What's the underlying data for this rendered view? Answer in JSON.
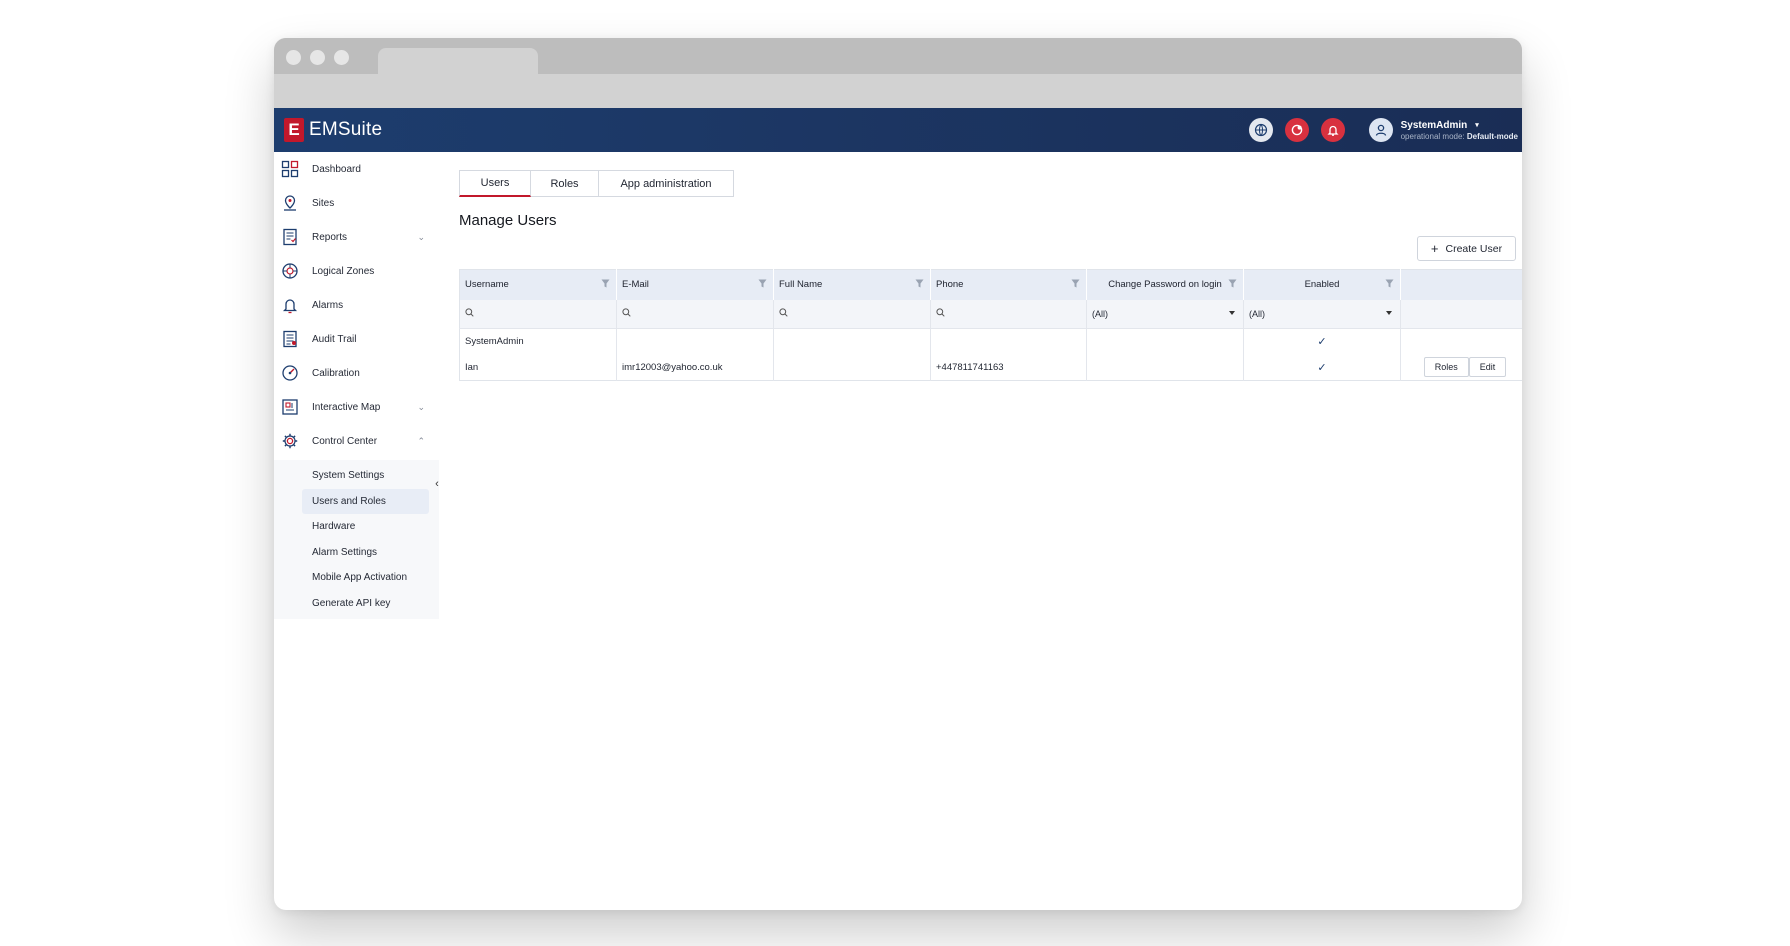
{
  "app": {
    "logo_letter": "E",
    "name": "EMSuite"
  },
  "header": {
    "user_name": "SystemAdmin",
    "mode_label": "operational mode:",
    "mode_value": "Default-mode",
    "accent": "#c2182b",
    "header_bg": "#1d3d6e"
  },
  "sidebar": {
    "items": [
      {
        "label": "Dashboard",
        "icon": "dashboard-icon"
      },
      {
        "label": "Sites",
        "icon": "location-pin-icon"
      },
      {
        "label": "Reports",
        "icon": "report-icon",
        "expandable": true
      },
      {
        "label": "Logical Zones",
        "icon": "zones-icon"
      },
      {
        "label": "Alarms",
        "icon": "bell-icon"
      },
      {
        "label": "Audit Trail",
        "icon": "audit-icon"
      },
      {
        "label": "Calibration",
        "icon": "gauge-icon"
      },
      {
        "label": "Interactive Map",
        "icon": "map-icon",
        "expandable": true
      },
      {
        "label": "Control Center",
        "icon": "gear-icon",
        "expanded": true
      }
    ],
    "sub_items": [
      "System Settings",
      "Users and Roles",
      "Hardware",
      "Alarm Settings",
      "Mobile App Activation",
      "Generate API key"
    ],
    "active_sub_item": "Users and Roles"
  },
  "tabs": [
    "Users",
    "Roles",
    "App administration"
  ],
  "active_tab": "Users",
  "page_title": "Manage Users",
  "create_button": "Create User",
  "table": {
    "columns": [
      "Username",
      "E-Mail",
      "Full Name",
      "Phone",
      "Change Password on login",
      "Enabled"
    ],
    "filters": {
      "change_password": "(All)",
      "enabled": "(All)"
    },
    "rows": [
      {
        "username": "SystemAdmin",
        "email": "",
        "full_name": "",
        "phone": "",
        "change_password": "",
        "enabled": "✓"
      },
      {
        "username": "Ian",
        "email": "imr12003@yahoo.co.uk",
        "full_name": "",
        "phone": "+447811741163",
        "change_password": "",
        "enabled": "✓",
        "actions": [
          "Roles",
          "Edit"
        ]
      }
    ]
  }
}
